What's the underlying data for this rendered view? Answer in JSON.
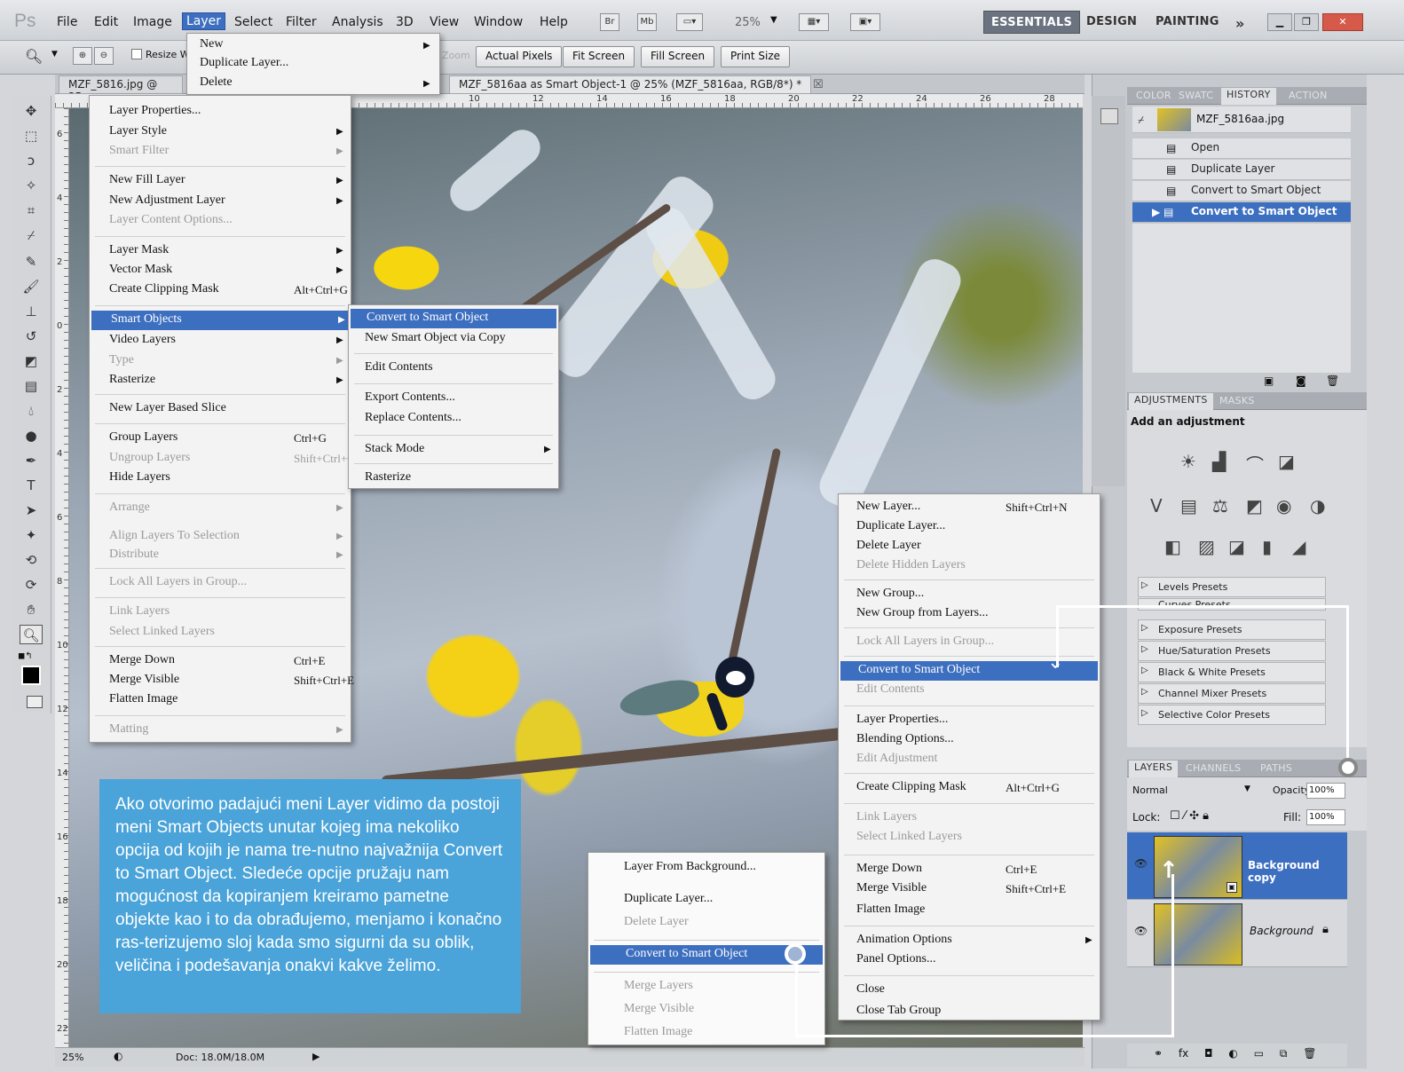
{
  "app": {
    "logo": "Ps"
  },
  "menubar": {
    "items": [
      "File",
      "Edit",
      "Image",
      "Layer",
      "Select",
      "Filter",
      "Analysis",
      "3D",
      "View",
      "Window",
      "Help"
    ],
    "zoom": "25%",
    "workspaces": [
      "ESSENTIALS",
      "DESIGN",
      "PAINTING"
    ],
    "more": "»"
  },
  "options": {
    "resize": "Resize W",
    "zoom_label": "Zoom",
    "buttons": [
      "Actual Pixels",
      "Fit Screen",
      "Fill Screen",
      "Print Size"
    ]
  },
  "documents": {
    "tab1": "MZF_5816.jpg @ 25",
    "tab2": "MZF_5816aa as Smart Object-1 @ 25% (MZF_5816aa, RGB/8*) *",
    "close": "☒"
  },
  "rulers": {
    "h": [
      "10",
      "12",
      "14",
      "16",
      "18",
      "20",
      "22",
      "24",
      "26",
      "28"
    ],
    "v": [
      "6",
      "4",
      "2",
      "0",
      "2",
      "4",
      "6",
      "8",
      "10",
      "12",
      "14",
      "16",
      "18",
      "20",
      "22"
    ]
  },
  "status": {
    "zoom": "25%",
    "doc": "Doc: 18.0M/18.0M"
  },
  "layer_menu": {
    "top": [
      {
        "label": "New",
        "arrow": "▶"
      },
      {
        "label": "Duplicate Layer..."
      },
      {
        "label": "Delete",
        "arrow": "▶"
      }
    ],
    "items": [
      {
        "label": "Layer Properties..."
      },
      {
        "label": "Layer Style",
        "arrow": "▶"
      },
      {
        "label": "Smart Filter",
        "arrow": "▶",
        "disabled": true
      },
      {
        "label": "New Fill Layer",
        "arrow": "▶"
      },
      {
        "label": "New Adjustment Layer",
        "arrow": "▶"
      },
      {
        "label": "Layer Content Options...",
        "disabled": true
      },
      {
        "label": "Layer Mask",
        "arrow": "▶"
      },
      {
        "label": "Vector Mask",
        "arrow": "▶"
      },
      {
        "label": "Create Clipping Mask",
        "key": "Alt+Ctrl+G"
      },
      {
        "label": "Smart Objects",
        "arrow": "▶",
        "highlight": true
      },
      {
        "label": "Video Layers",
        "arrow": "▶"
      },
      {
        "label": "Type",
        "arrow": "▶",
        "disabled": true
      },
      {
        "label": "Rasterize",
        "arrow": "▶"
      },
      {
        "label": "New Layer Based Slice"
      },
      {
        "label": "Group Layers",
        "key": "Ctrl+G"
      },
      {
        "label": "Ungroup Layers",
        "key": "Shift+Ctrl+G",
        "disabled": true
      },
      {
        "label": "Hide Layers"
      },
      {
        "label": "Arrange",
        "arrow": "▶",
        "disabled": true
      },
      {
        "label": "Align Layers To Selection",
        "arrow": "▶",
        "disabled": true
      },
      {
        "label": "Distribute",
        "arrow": "▶",
        "disabled": true
      },
      {
        "label": "Lock All Layers in Group...",
        "disabled": true
      },
      {
        "label": "Link Layers",
        "disabled": true
      },
      {
        "label": "Select Linked Layers",
        "disabled": true
      },
      {
        "label": "Merge Down",
        "key": "Ctrl+E"
      },
      {
        "label": "Merge Visible",
        "key": "Shift+Ctrl+E"
      },
      {
        "label": "Flatten Image"
      },
      {
        "label": "Matting",
        "arrow": "▶",
        "disabled": true
      }
    ]
  },
  "smart_menu": {
    "items": [
      {
        "label": "Convert to Smart Object",
        "highlight": true
      },
      {
        "label": "New Smart Object via Copy"
      },
      {
        "label": "Edit Contents"
      },
      {
        "label": "Export Contents..."
      },
      {
        "label": "Replace Contents..."
      },
      {
        "label": "Stack Mode",
        "arrow": "▶"
      },
      {
        "label": "Rasterize"
      }
    ]
  },
  "panel_menu": {
    "items": [
      {
        "label": "New Layer...",
        "key": "Shift+Ctrl+N"
      },
      {
        "label": "Duplicate Layer..."
      },
      {
        "label": "Delete Layer"
      },
      {
        "label": "Delete Hidden Layers",
        "disabled": true
      },
      {
        "label": "New Group..."
      },
      {
        "label": "New Group from Layers..."
      },
      {
        "label": "Lock All Layers in Group...",
        "disabled": true
      },
      {
        "label": "Convert to Smart Object",
        "highlight": true
      },
      {
        "label": "Edit Contents",
        "disabled": true
      },
      {
        "label": "Layer Properties..."
      },
      {
        "label": "Blending Options..."
      },
      {
        "label": "Edit Adjustment",
        "disabled": true
      },
      {
        "label": "Create Clipping Mask",
        "key": "Alt+Ctrl+G"
      },
      {
        "label": "Link Layers",
        "disabled": true
      },
      {
        "label": "Select Linked Layers",
        "disabled": true
      },
      {
        "label": "Merge Down",
        "key": "Ctrl+E"
      },
      {
        "label": "Merge Visible",
        "key": "Shift+Ctrl+E"
      },
      {
        "label": "Flatten Image"
      },
      {
        "label": "Animation Options",
        "arrow": "▶"
      },
      {
        "label": "Panel Options..."
      },
      {
        "label": "Close"
      },
      {
        "label": "Close Tab Group"
      }
    ]
  },
  "context_menu": {
    "items": [
      {
        "label": "Layer From Background..."
      },
      {
        "label": "Duplicate Layer..."
      },
      {
        "label": "Delete Layer",
        "disabled": true
      },
      {
        "label": "Convert to Smart Object",
        "highlight": true
      },
      {
        "label": "Merge Layers",
        "disabled": true
      },
      {
        "label": "Merge Visible",
        "disabled": true
      },
      {
        "label": "Flatten Image",
        "disabled": true
      }
    ]
  },
  "history": {
    "tabs": [
      "COLOR",
      "SWATC",
      "HISTORY",
      "ACTION"
    ],
    "snapshot": "MZF_5816aa.jpg",
    "items": [
      "Open",
      "Duplicate Layer",
      "Convert to Smart Object",
      "Convert to Smart Object"
    ]
  },
  "adjustments": {
    "tabs": [
      "ADJUSTMENTS",
      "MASKS"
    ],
    "title": "Add an adjustment",
    "presets": [
      "Levels Presets",
      "Curves Presets",
      "Exposure Presets",
      "Hue/Saturation Presets",
      "Black & White Presets",
      "Channel Mixer Presets",
      "Selective Color Presets"
    ]
  },
  "layers": {
    "tabs": [
      "LAYERS",
      "CHANNELS",
      "PATHS"
    ],
    "blend": "Normal",
    "opacity_label": "Opacity:",
    "opacity": "100%",
    "lock_label": "Lock:",
    "fill_label": "Fill:",
    "fill": "100%",
    "items": [
      {
        "name": "Background copy",
        "selected": true
      },
      {
        "name": "Background",
        "italic": true
      }
    ]
  },
  "caption": "Ako otvorimo padajući meni Layer vidimo da postoji meni Smart Objects unutar kojeg ima nekoliko opcija od kojih je nama tre-nutno najvažnija Convert to Smart Object. Sledeće opcije pružaju nam mogućnost da kopiranjem kreiramo pametne objekte kao i to da obrađujemo, menjamo i konačno ras-terizujemo sloj kada smo sigurni da su oblik, veličina i podešavanja onakvi kakve želimo.",
  "colors": {
    "accent": "#3d6fc0",
    "caption_bg": "#4aa3d9"
  }
}
